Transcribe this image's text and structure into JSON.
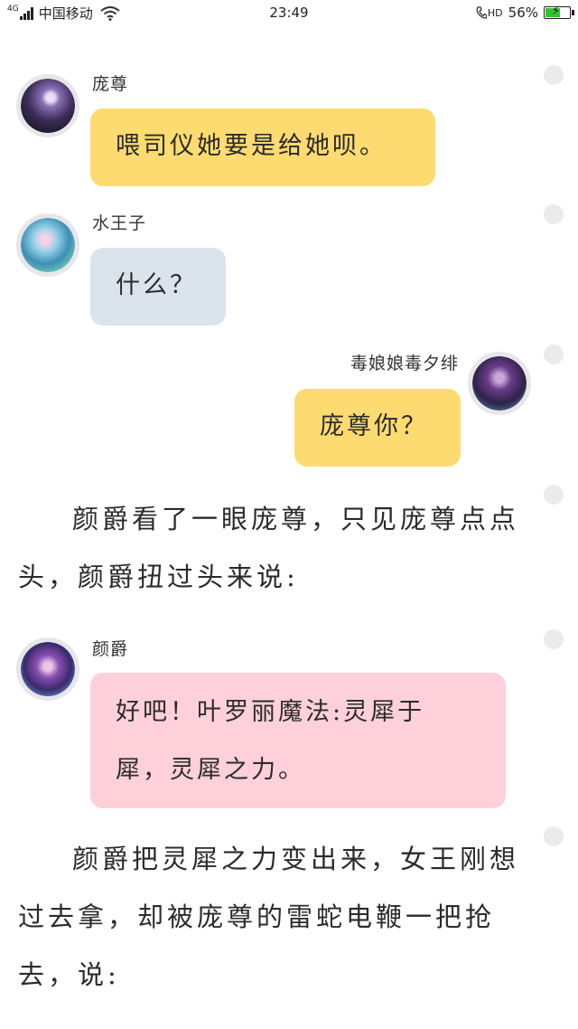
{
  "status_bar": {
    "network": "4G",
    "carrier": "中国移动",
    "time": "23:49",
    "hd": "HD",
    "battery_percent": "56%",
    "battery_level": 0.56,
    "battery_color": "#35c232"
  },
  "messages": [
    {
      "sender": "庞尊",
      "text": "喂司仪她要是给她呗。",
      "bubble_color": "#fddb70",
      "avatar": "purple-armored-warrior"
    },
    {
      "sender": "水王子",
      "text": "什么？",
      "bubble_color": "#dbe3ec",
      "avatar": "blue-water-prince"
    },
    {
      "sender": "毒娘娘毒夕绯",
      "text": "庞尊你？",
      "bubble_color": "#fddb70",
      "avatar": "dark-sorceress"
    },
    {
      "sender": "颜爵",
      "text": "好吧！叶罗丽魔法:灵犀于犀，灵犀之力。",
      "bubble_color": "#fdd0da",
      "avatar": "purple-haired-youth"
    }
  ],
  "narration": [
    "颜爵看了一眼庞尊，只见庞尊点点头，颜爵扭过头来说:",
    "颜爵把灵犀之力变出来，女王刚想过去拿，却被庞尊的雷蛇电鞭一把抢去，说:"
  ],
  "icons": {
    "signal": "signal-bars-icon",
    "wifi": "wifi-icon",
    "call": "phone-hd-icon",
    "battery": "battery-charging-icon"
  }
}
